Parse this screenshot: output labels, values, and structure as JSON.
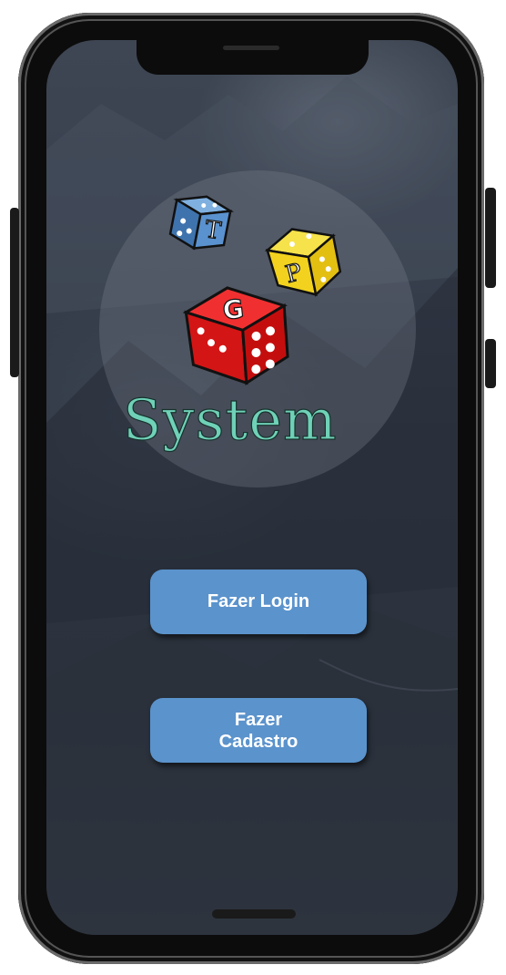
{
  "logo": {
    "dice_letters": [
      "T",
      "P",
      "G"
    ],
    "system_label": "System",
    "colors": {
      "blue_die": "#4e86c6",
      "yellow_die": "#f2d21e",
      "red_die": "#e01818",
      "text": "#6fd1b8"
    }
  },
  "actions": {
    "login_label": "Fazer Login",
    "signup_label_line1": "Fazer",
    "signup_label_line2": "Cadastro",
    "button_color": "#5b93cc"
  }
}
